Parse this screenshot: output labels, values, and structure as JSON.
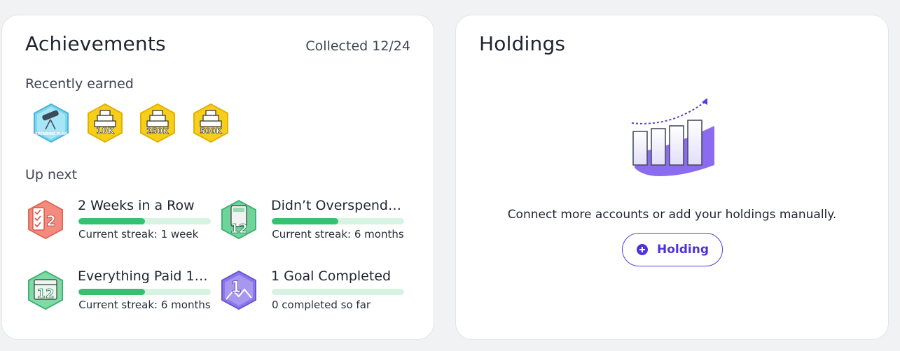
{
  "achievements": {
    "title": "Achievements",
    "collected": "Collected 12/24",
    "recently_earned_label": "Recently earned",
    "recent_badges": [
      {
        "icon": "telescope-badge-icon",
        "text": "SPENDING PLAN"
      },
      {
        "icon": "gold-bars-badge-icon",
        "text": "10K"
      },
      {
        "icon": "gold-bars-badge-icon",
        "text": "250K"
      },
      {
        "icon": "gold-bars-badge-icon",
        "text": "500K"
      }
    ],
    "up_next_label": "Up next",
    "up_next": [
      {
        "title": "2 Weeks in a Row",
        "subtitle": "Current streak: 1 week",
        "progress": 0.5,
        "icon": "checklist-badge-icon",
        "badge_number": "2"
      },
      {
        "title": "Didn’t Overspend…",
        "subtitle": "Current streak: 6 months",
        "progress": 0.5,
        "icon": "calculator-badge-icon",
        "badge_number": "12"
      },
      {
        "title": "Everything Paid 1…",
        "subtitle": "Current streak: 6 months",
        "progress": 0.5,
        "icon": "calendar-badge-icon",
        "badge_number": "12"
      },
      {
        "title": "1 Goal Completed",
        "subtitle": "0 completed so far",
        "progress": 0,
        "icon": "mountain-goal-badge-icon",
        "badge_number": "1"
      }
    ]
  },
  "holdings": {
    "title": "Holdings",
    "description": "Connect more accounts or add your holdings manually.",
    "button_label": "Holding",
    "illustration_icon": "growth-chart-illustration-icon"
  },
  "colors": {
    "accent": "#5b3be6",
    "progress": "#36c070",
    "progress_track": "#d7f3e2"
  }
}
